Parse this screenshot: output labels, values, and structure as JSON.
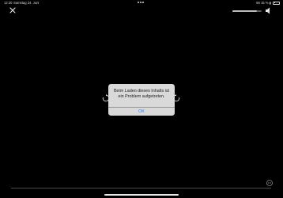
{
  "status_bar": {
    "time": "12:20",
    "date": "Samstag 24. Juni",
    "battery_label": "66 15 % ▮"
  },
  "alert": {
    "message": "Beim Laden dieses Inhalts ist ein Problem aufgetreten.",
    "ok_label": "OK"
  },
  "player": {
    "volume_level": 0.85,
    "icons": [
      "close-icon",
      "speaker-icon",
      "skip-back-icon",
      "skip-forward-icon",
      "more-icon"
    ]
  },
  "colors": {
    "background": "#000000",
    "alert_bg": "#d9d9d9",
    "accent": "#2f7cf6"
  }
}
